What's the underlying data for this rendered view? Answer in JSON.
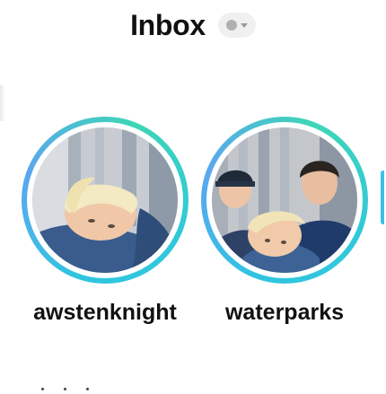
{
  "header": {
    "title": "Inbox",
    "status_icon": "status-dot-icon",
    "dropdown_icon": "chevron-down-icon"
  },
  "stories": [
    {
      "username": "awstenknight",
      "avatar_icon": "profile-photo"
    },
    {
      "username": "waterparks",
      "avatar_icon": "profile-photo"
    }
  ],
  "colors": {
    "ring_accent": "#2fc5e0",
    "ring_secondary": "#5ba6f0",
    "status_dot": "#b0b0b0",
    "chip_bg": "#f0f0f0"
  }
}
